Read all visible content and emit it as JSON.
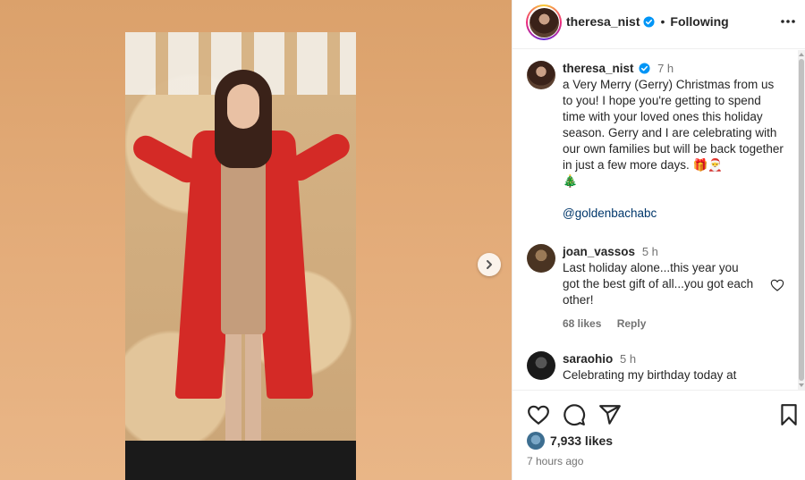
{
  "post": {
    "header": {
      "username": "theresa_nist",
      "separator": "•",
      "follow_status": "Following"
    },
    "comments": [
      {
        "username": "theresa_nist",
        "verified": true,
        "time": "7 h",
        "text": "a Very Merry (Gerry) Christmas from us to you! I hope you're getting to spend time with your loved ones this holiday season. Gerry and I are celebrating with our own families but will be back together in just a few more days. 🎁🎅",
        "text2": "🎄",
        "mention": "@goldenbachabc"
      },
      {
        "username": "joan_vassos",
        "time": "5 h",
        "text": "Last holiday alone...this year you got the best gift of all...you got each other!",
        "likes": "68 likes",
        "reply": "Reply"
      },
      {
        "username": "saraohio",
        "time": "5 h",
        "text": "Celebrating my birthday today at"
      }
    ],
    "likes_count": "7,933 likes",
    "posted_ago": "7 hours ago"
  },
  "colors": {
    "background_media": "#dba16b",
    "verified_blue": "#0095f6",
    "mention_blue": "#00376b",
    "coat_red": "#d42a26"
  },
  "icons": {
    "header_more": "more-horizontal-icon",
    "verified": "verified-badge-icon",
    "like": "heart-icon",
    "comment": "comment-icon",
    "share": "send-icon",
    "save": "bookmark-icon",
    "carousel_next": "chevron-right-icon"
  }
}
